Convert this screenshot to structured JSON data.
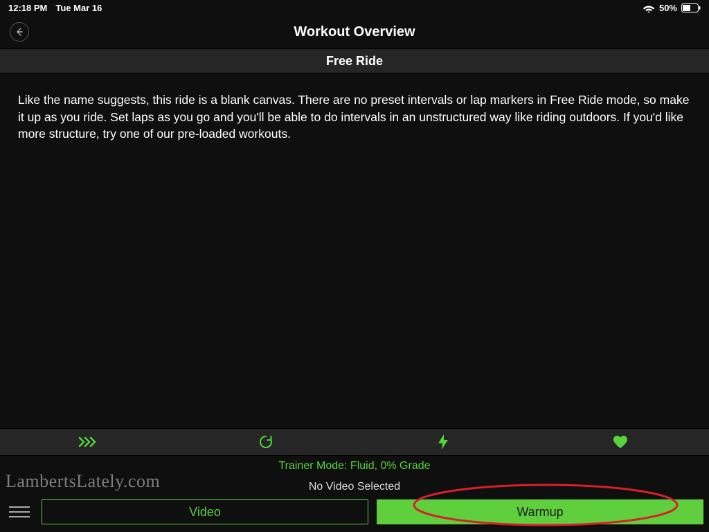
{
  "status": {
    "time": "12:18 PM",
    "date": "Tue Mar 16",
    "battery_pct": "50%"
  },
  "header": {
    "title": "Workout Overview"
  },
  "subtitle": "Free Ride",
  "description": "Like the name suggests, this ride is a blank canvas. There are no preset intervals or lap markers in Free Ride mode, so make it up as you ride. Set laps as you go and you'll be able to do intervals in an unstructured way like riding outdoors. If you'd like more structure, try one of our pre-loaded workouts.",
  "tabs": {
    "skip_icon": "skip-forward-icon",
    "refresh_icon": "refresh-icon",
    "power_icon": "bolt-icon",
    "heart_icon": "heart-icon"
  },
  "trainer_mode_text": "Trainer Mode: Fluid, 0% Grade",
  "video_status_text": "No Video Selected",
  "actions": {
    "video_label": "Video",
    "warmup_label": "Warmup"
  },
  "watermark": "LambertsLately.com",
  "colors": {
    "accent_green": "#55d43a",
    "solid_green": "#5fcf3d",
    "annotation_red": "#d6202a"
  }
}
